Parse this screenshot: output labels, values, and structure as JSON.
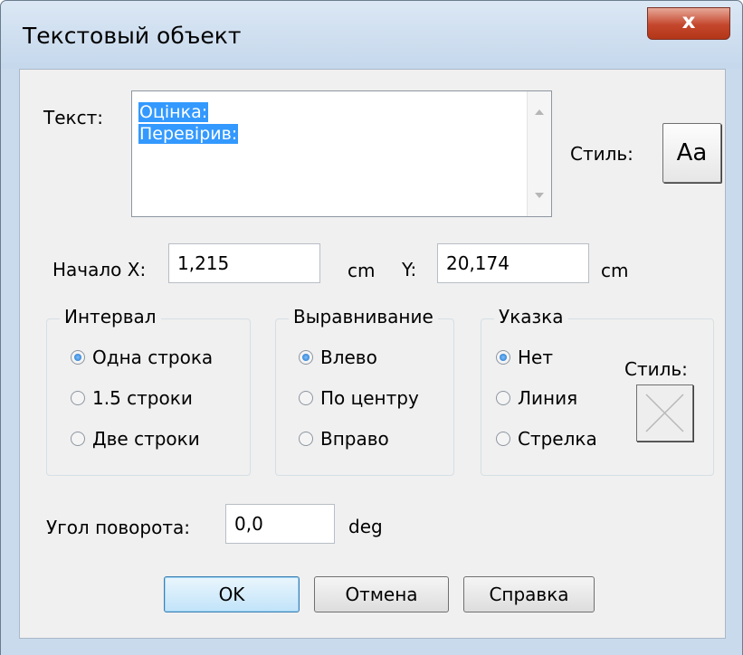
{
  "window": {
    "title": "Текстовый объект",
    "close_label": "x"
  },
  "text_section": {
    "label": "Текст:",
    "lines": [
      "Оцінка:",
      "Перевірив:"
    ],
    "style_label": "Стиль:",
    "style_button": "Aa"
  },
  "position": {
    "x_label": "Начало X:",
    "x_value": "1,215",
    "x_unit": "cm",
    "y_label": "Y:",
    "y_value": "20,174",
    "y_unit": "cm"
  },
  "interval": {
    "title": "Интервал",
    "options": [
      "Одна строка",
      "1.5 строки",
      "Две строки"
    ],
    "selected": "Одна строка"
  },
  "alignment": {
    "title": "Выравнивание",
    "options": [
      "Влево",
      "По центру",
      "Вправо"
    ],
    "selected": "Влево"
  },
  "pointer": {
    "title": "Указка",
    "options": [
      "Нет",
      "Линия",
      "Стрелка"
    ],
    "selected": "Нет",
    "style_label": "Стиль:"
  },
  "rotation": {
    "label": "Угол поворота:",
    "value": "0,0",
    "unit": "deg"
  },
  "buttons": {
    "ok": "OK",
    "cancel": "Отмена",
    "help": "Справка"
  },
  "colors": {
    "selection": "#3399ff",
    "title_bar": "#c9daec",
    "close": "#c4462c",
    "dialog_bg": "#f0f0f0"
  },
  "icons": {
    "close": "close-icon",
    "pointer_style": "cross-icon"
  }
}
